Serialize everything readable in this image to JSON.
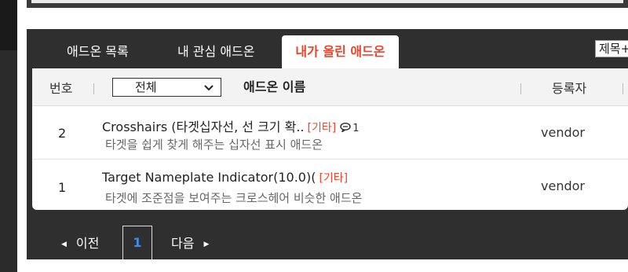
{
  "tabs": [
    {
      "label": "애드온 목록"
    },
    {
      "label": "내 관심 애드온"
    },
    {
      "label": "내가 올린 애드온",
      "active": true
    }
  ],
  "search": {
    "select_value": "제목+"
  },
  "header": {
    "num_label": "번호",
    "category_select": "전체",
    "name_label": "애드온 이름",
    "author_label": "등록자"
  },
  "rows": [
    {
      "num": "2",
      "title": "Crosshairs (타겟십자선, 선 크기 확..",
      "category": "[기타]",
      "comments": "1",
      "description": "타겟을 쉽게 찾게 해주는 십자선 표시 애드온",
      "author": "vendor"
    },
    {
      "num": "1",
      "title": "Target Nameplate Indicator(10.0)(",
      "category": "[기타]",
      "description": "타겟에 조준점을 보여주는 크로스헤어 비슷한 애드온",
      "author": "vendor"
    }
  ],
  "pager": {
    "prev": "이전",
    "current": "1",
    "next": "다음"
  },
  "colors": {
    "accent": "#e8452b",
    "page_active": "#3d8ef0",
    "panel_bg": "#2f2f2f"
  }
}
